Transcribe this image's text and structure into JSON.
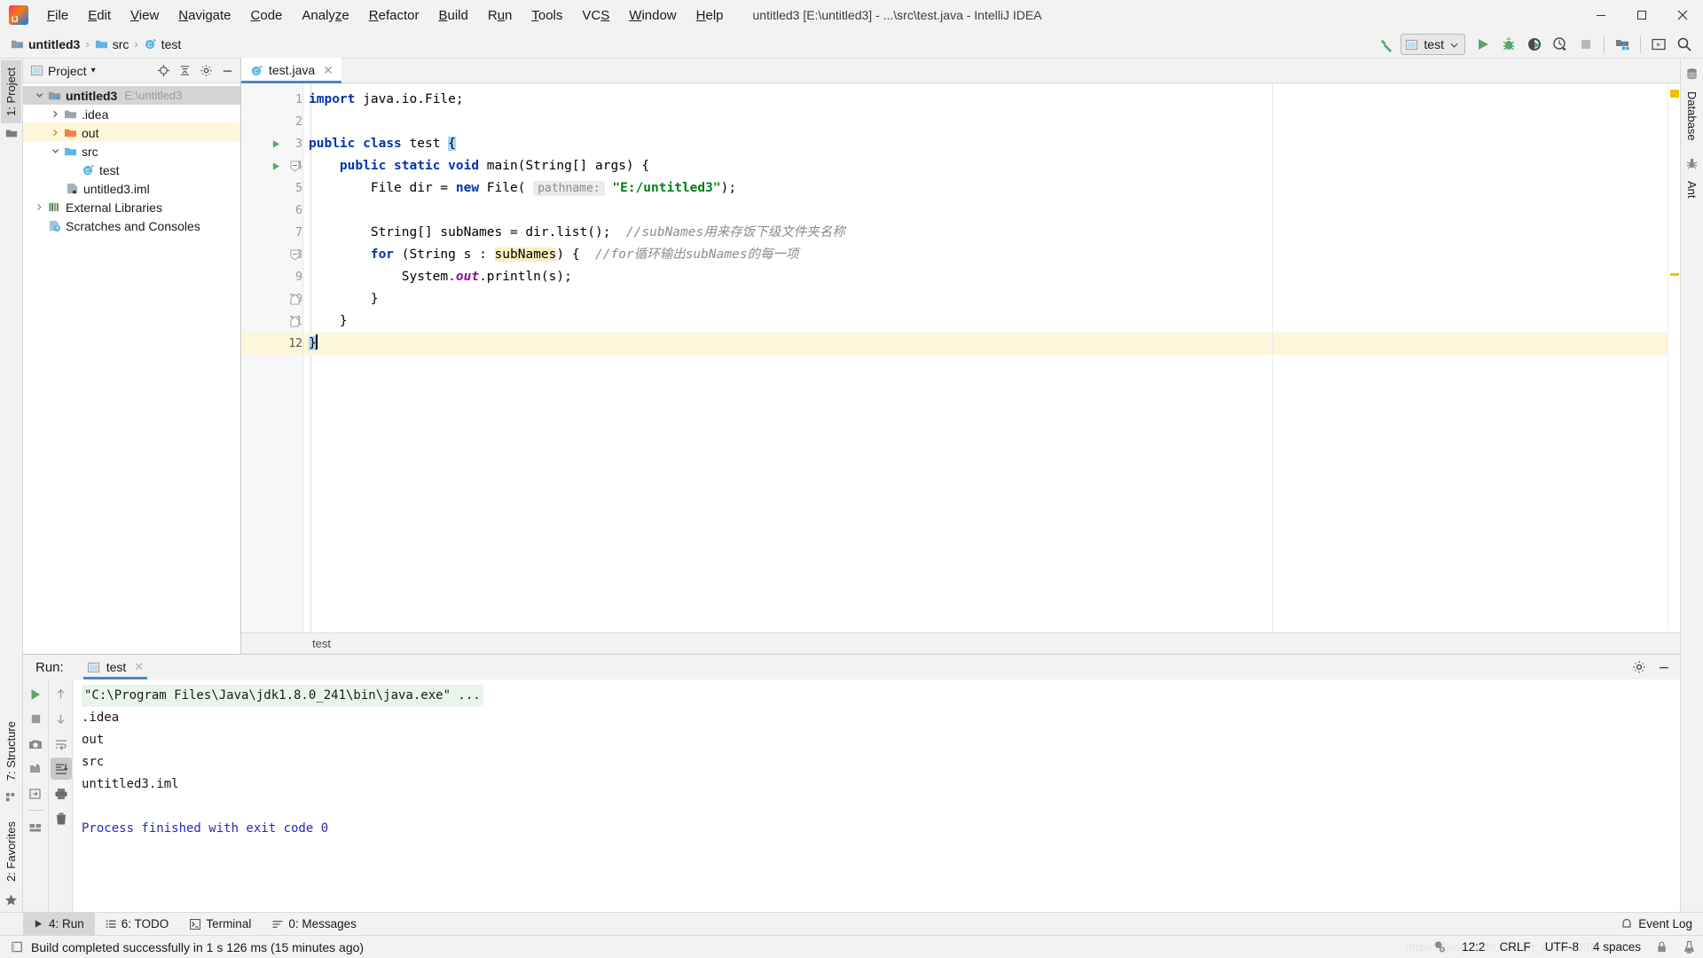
{
  "window": {
    "title": "untitled3 [E:\\untitled3] - ...\\src\\test.java - IntelliJ IDEA",
    "app_name": "IntelliJ IDEA",
    "minimize": "–",
    "maximize": "❐",
    "close": "✕"
  },
  "menubar": {
    "items": [
      {
        "label": "File"
      },
      {
        "label": "Edit"
      },
      {
        "label": "View"
      },
      {
        "label": "Navigate"
      },
      {
        "label": "Code"
      },
      {
        "label": "Analyze"
      },
      {
        "label": "Refactor"
      },
      {
        "label": "Build"
      },
      {
        "label": "Run"
      },
      {
        "label": "Tools"
      },
      {
        "label": "VCS"
      },
      {
        "label": "Window"
      },
      {
        "label": "Help"
      }
    ]
  },
  "navbar": {
    "breadcrumbs": [
      {
        "label": "untitled3",
        "icon": "project-module-icon"
      },
      {
        "label": "src",
        "icon": "folder-icon"
      },
      {
        "label": "test",
        "icon": "java-class-icon"
      }
    ],
    "separator": "›",
    "run_config": {
      "name": "test",
      "icon": "run-config-icon",
      "chevron": "⌄"
    },
    "buttons": [
      {
        "name": "build-hammer-button",
        "icon": "hammer-icon"
      },
      {
        "name": "run-button",
        "icon": "play-icon"
      },
      {
        "name": "debug-button",
        "icon": "bug-icon"
      },
      {
        "name": "run-with-coverage-button",
        "icon": "coverage-icon"
      },
      {
        "name": "profile-button",
        "icon": "profiler-icon"
      },
      {
        "name": "stop-button",
        "icon": "stop-icon"
      },
      {
        "name": "project-structure-button",
        "icon": "project-structure-icon"
      },
      {
        "name": "select-opened-file-button",
        "icon": "window-icon"
      },
      {
        "name": "search-everywhere-button",
        "icon": "search-icon"
      }
    ]
  },
  "left_strip": {
    "top": [
      {
        "label": "1: Project",
        "accesskey": "1",
        "icon": "project-folder-icon",
        "active": true
      }
    ],
    "bottom": [
      {
        "label": "7: Structure",
        "accesskey": "7",
        "icon": "structure-icon",
        "active": false
      },
      {
        "label": "2: Favorites",
        "accesskey": "2",
        "icon": "star-icon",
        "active": false
      }
    ]
  },
  "right_strip": {
    "items": [
      {
        "label": "Database",
        "icon": "database-icon"
      },
      {
        "label": "Ant",
        "icon": "ant-icon"
      }
    ]
  },
  "project_panel": {
    "title": "Project",
    "title_chevron": "▾",
    "header_buttons": [
      {
        "name": "locate-file-button",
        "icon": "target-icon"
      },
      {
        "name": "collapse-all-button",
        "icon": "collapse-all-icon"
      },
      {
        "name": "settings-button",
        "icon": "gear-icon"
      },
      {
        "name": "hide-panel-button",
        "icon": "minimize-icon"
      }
    ],
    "tree": [
      {
        "label": "untitled3",
        "path": "E:\\untitled3",
        "indent": 0,
        "arrow": "down",
        "icon": "project-module-icon",
        "state": "selected",
        "bold": true
      },
      {
        "label": ".idea",
        "path": "",
        "indent": 1,
        "arrow": "right",
        "icon": "folder-gray-icon",
        "state": "",
        "bold": false
      },
      {
        "label": "out",
        "path": "",
        "indent": 1,
        "arrow": "right",
        "icon": "folder-orange-icon",
        "state": "highlight",
        "bold": false
      },
      {
        "label": "src",
        "path": "",
        "indent": 1,
        "arrow": "down",
        "icon": "folder-blue-icon",
        "state": "",
        "bold": false
      },
      {
        "label": "test",
        "path": "",
        "indent": 2,
        "arrow": "none",
        "icon": "java-class-icon",
        "state": "",
        "bold": false
      },
      {
        "label": "untitled3.iml",
        "path": "",
        "indent": 1,
        "arrow": "none",
        "icon": "iml-file-icon",
        "state": "",
        "bold": false
      },
      {
        "label": "External Libraries",
        "path": "",
        "indent": 0,
        "arrow": "right",
        "icon": "libraries-icon",
        "state": "",
        "bold": false
      },
      {
        "label": "Scratches and Consoles",
        "path": "",
        "indent": 0,
        "arrow": "none",
        "icon": "scratches-icon",
        "state": "",
        "bold": false
      }
    ]
  },
  "editor": {
    "tab": {
      "label": "test.java",
      "icon": "java-class-icon",
      "close": "✕"
    },
    "breadcrumb": "test",
    "caret_position": "12:2",
    "lines": [
      {
        "num": "1",
        "marker": "none",
        "fold": "none",
        "current": false
      },
      {
        "num": "2",
        "marker": "none",
        "fold": "none",
        "current": false
      },
      {
        "num": "3",
        "marker": "run",
        "fold": "none",
        "current": false
      },
      {
        "num": "4",
        "marker": "run",
        "fold": "start",
        "current": false
      },
      {
        "num": "5",
        "marker": "none",
        "fold": "none",
        "current": false
      },
      {
        "num": "6",
        "marker": "none",
        "fold": "none",
        "current": false
      },
      {
        "num": "7",
        "marker": "none",
        "fold": "none",
        "current": false
      },
      {
        "num": "8",
        "marker": "none",
        "fold": "start",
        "current": false
      },
      {
        "num": "9",
        "marker": "none",
        "fold": "none",
        "current": false
      },
      {
        "num": "10",
        "marker": "none",
        "fold": "end",
        "current": false
      },
      {
        "num": "11",
        "marker": "none",
        "fold": "end",
        "current": false
      },
      {
        "num": "12",
        "marker": "none",
        "fold": "none",
        "current": true
      }
    ],
    "code": {
      "l1_kw": "import",
      "l1_rest": " java.io.File;",
      "l3_kw1": "public",
      "l3_kw2": "class",
      "l3_name": " test ",
      "l3_brace": "{",
      "l4_kw": "public static void",
      "l4_rest": " main(String[] args) {",
      "l5_pre": "        File dir = ",
      "l5_kw": "new",
      "l5_mid": " File( ",
      "l5_hint": "pathname:",
      "l5_str": "\"E:/untitled3\"",
      "l5_end": ");",
      "l7_code": "        String[] subNames = dir.list();  ",
      "l7_comment": "//subNames用来存饭下级文件夹名称",
      "l8_kw": "for",
      "l8_mid": " (String s : ",
      "l8_ident": "subNames",
      "l8_end": ") {  ",
      "l8_comment": "//for循环输出subNames的每一项",
      "l9_pre": "            System.",
      "l9_fld": "out",
      "l9_end": ".println(s);",
      "l10": "        }",
      "l11": "    }",
      "l12": "}"
    }
  },
  "run_panel": {
    "label": "Run:",
    "tab": {
      "label": "test",
      "icon": "run-config-icon",
      "close": "✕"
    },
    "header_buttons": [
      {
        "name": "run-settings-button",
        "icon": "gear-icon"
      },
      {
        "name": "hide-run-panel-button",
        "icon": "minimize-icon"
      }
    ],
    "left_tools": [
      {
        "name": "rerun-button",
        "icon": "play-icon"
      },
      {
        "name": "stop-button",
        "icon": "stop-icon"
      },
      {
        "name": "dump-threads-button",
        "icon": "camera-icon"
      },
      {
        "name": "restore-layout-button",
        "icon": "restore-layout-icon"
      },
      {
        "name": "pin-tab-button",
        "icon": "pin-tab-icon"
      },
      {
        "name": "layout-settings-button",
        "icon": "layout-icon"
      }
    ],
    "right_tools": [
      {
        "name": "scroll-up-button",
        "icon": "arrow-up-icon"
      },
      {
        "name": "scroll-down-button",
        "icon": "arrow-down-icon"
      },
      {
        "name": "soft-wrap-button",
        "icon": "soft-wrap-icon"
      },
      {
        "name": "scroll-to-end-button",
        "icon": "scroll-end-icon",
        "active": true
      },
      {
        "name": "print-button",
        "icon": "printer-icon"
      },
      {
        "name": "clear-all-button",
        "icon": "trash-icon"
      }
    ],
    "console": {
      "command": "\"C:\\Program Files\\Java\\jdk1.8.0_241\\bin\\java.exe\" ...",
      "output": [
        ".idea",
        "out",
        "src",
        "untitled3.iml",
        "",
        ""
      ],
      "finished": "Process finished with exit code 0"
    }
  },
  "bottom_strip": {
    "tabs": [
      {
        "label": "4: Run",
        "accesskey": "4",
        "icon": "play-icon",
        "active": true
      },
      {
        "label": "6: TODO",
        "accesskey": "6",
        "icon": "todo-icon",
        "active": false
      },
      {
        "label": "Terminal",
        "accesskey": "",
        "icon": "terminal-icon",
        "active": false
      },
      {
        "label": "0: Messages",
        "accesskey": "0",
        "icon": "messages-icon",
        "active": false
      }
    ],
    "event_log": {
      "label": "Event Log",
      "icon": "event-log-icon"
    }
  },
  "statusbar": {
    "message": "Build completed successfully in 1 s 126 ms (15 minutes ago)",
    "message_icon": "notification-icon",
    "caret": "12:2",
    "line_separator": "CRLF",
    "encoding": "UTF-8",
    "indent": "4 spaces",
    "lock_icon": "lock-icon",
    "inspection_icon": "inspection-icon",
    "watermark": "https://blog.csdn.net/qq_44509095"
  },
  "colors": {
    "accent_blue": "#4a86c8",
    "keyword": "#0033b3",
    "string": "#067d17",
    "comment": "#8c8c8c",
    "field": "#871094",
    "highlight_line": "#fdf6d8",
    "selection": "#a5d5f5",
    "green_run": "#59a869",
    "warning_yellow": "#f0c000"
  }
}
